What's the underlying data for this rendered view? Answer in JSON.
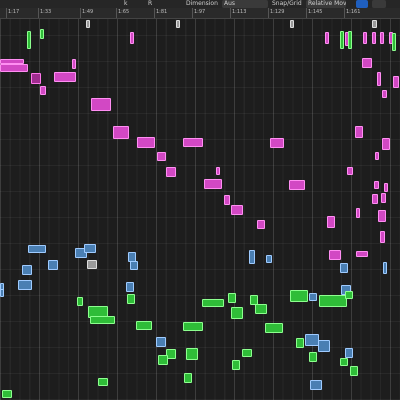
{
  "toolbar": {
    "glyph_a": "k",
    "glyph_b": "R",
    "dimension_label": "Dimension",
    "dimension_value": "Aus",
    "snap_label": "Snap/Grid",
    "quantize_value": "Relative Movement",
    "btn_1": "",
    "btn_2": ""
  },
  "ruler": {
    "bars": [
      "1:17",
      "1:33",
      "1:49",
      "1:65",
      "1:81",
      "1:97",
      "1:113",
      "1:129",
      "1:145",
      "1:161"
    ]
  },
  "regions": [
    {
      "label": "",
      "color": "gray"
    },
    {
      "label": "",
      "color": "gray"
    },
    {
      "label": "",
      "color": "gray"
    },
    {
      "label": "",
      "color": "gray"
    },
    {
      "label": "",
      "color": "pink"
    },
    {
      "label": "",
      "color": "pink"
    },
    {
      "label": "",
      "color": "pink"
    },
    {
      "label": "",
      "color": "pink"
    },
    {
      "label": "",
      "color": "pink"
    },
    {
      "label": "",
      "color": "pink"
    },
    {
      "label": "",
      "color": "pink"
    },
    {
      "label": "",
      "color": "green"
    },
    {
      "label": "",
      "color": "green"
    },
    {
      "label": "",
      "color": "green"
    },
    {
      "label": "",
      "color": "green"
    },
    {
      "label": "",
      "color": "green"
    },
    {
      "label": "",
      "color": "pink"
    },
    {
      "label": "",
      "color": "pink"
    },
    {
      "label": "",
      "color": "pink"
    },
    {
      "label": "",
      "color": "pink"
    },
    {
      "label": "",
      "color": "dpink"
    },
    {
      "label": "",
      "color": "pink"
    },
    {
      "label": "",
      "color": "pink"
    },
    {
      "label": "",
      "color": "pink"
    },
    {
      "label": "",
      "color": "pink"
    },
    {
      "label": "",
      "color": "pink"
    },
    {
      "label": "",
      "color": "pink"
    },
    {
      "label": "",
      "color": "pink"
    },
    {
      "label": "",
      "color": "pink"
    },
    {
      "label": "",
      "color": "pink"
    },
    {
      "label": "",
      "color": "pink"
    },
    {
      "label": "",
      "color": "pink"
    },
    {
      "label": "",
      "color": "pink"
    },
    {
      "label": "",
      "color": "pink"
    },
    {
      "label": "",
      "color": "pink"
    },
    {
      "label": "",
      "color": "pink"
    },
    {
      "label": "",
      "color": "pink"
    },
    {
      "label": "",
      "color": "pink"
    },
    {
      "label": "",
      "color": "pink"
    },
    {
      "label": "",
      "color": "pink"
    },
    {
      "label": "",
      "color": "pink"
    },
    {
      "label": "",
      "color": "pink"
    },
    {
      "label": "",
      "color": "pink"
    },
    {
      "label": "",
      "color": "pink"
    },
    {
      "label": "",
      "color": "pink"
    },
    {
      "label": "",
      "color": "pink"
    },
    {
      "label": "",
      "color": "pink"
    },
    {
      "label": "",
      "color": "pink"
    },
    {
      "label": "",
      "color": "pink"
    },
    {
      "label": "",
      "color": "pink"
    },
    {
      "label": "",
      "color": "pink"
    },
    {
      "label": "",
      "color": "pink"
    },
    {
      "label": "",
      "color": "blue"
    },
    {
      "label": "",
      "color": "blue"
    },
    {
      "label": "",
      "color": "blue"
    },
    {
      "label": "",
      "color": "gray"
    },
    {
      "label": "",
      "color": "blue"
    },
    {
      "label": "",
      "color": "blue"
    },
    {
      "label": "",
      "color": "blue"
    },
    {
      "label": "",
      "color": "blue"
    },
    {
      "label": "",
      "color": "blue"
    },
    {
      "label": "",
      "color": "blue"
    },
    {
      "label": "",
      "color": "pink"
    },
    {
      "label": "",
      "color": "blue"
    },
    {
      "label": "",
      "color": "blue"
    },
    {
      "label": "",
      "color": "blue"
    },
    {
      "label": "",
      "color": "blue"
    },
    {
      "label": "",
      "color": "blue"
    },
    {
      "label": "",
      "color": "blue"
    },
    {
      "label": "",
      "color": "blue"
    },
    {
      "label": "",
      "color": "blue"
    },
    {
      "label": "",
      "color": "green"
    },
    {
      "label": "",
      "color": "green"
    },
    {
      "label": "",
      "color": "green"
    },
    {
      "label": "",
      "color": "green"
    },
    {
      "label": "",
      "color": "green"
    },
    {
      "label": "",
      "color": "green"
    },
    {
      "label": "",
      "color": "green"
    },
    {
      "label": "",
      "color": "green"
    },
    {
      "label": "",
      "color": "green"
    },
    {
      "label": "",
      "color": "green"
    },
    {
      "label": "",
      "color": "green"
    },
    {
      "label": "",
      "color": "green"
    },
    {
      "label": "",
      "color": "green"
    },
    {
      "label": "",
      "color": "green"
    },
    {
      "label": "",
      "color": "green"
    },
    {
      "label": "",
      "color": "green"
    },
    {
      "label": "",
      "color": "blue"
    },
    {
      "label": "",
      "color": "blue"
    },
    {
      "label": "",
      "color": "blue"
    },
    {
      "label": "",
      "color": "blue"
    },
    {
      "label": "",
      "color": "green"
    },
    {
      "label": "",
      "color": "green"
    },
    {
      "label": "",
      "color": "green"
    },
    {
      "label": "",
      "color": "green"
    },
    {
      "label": "",
      "color": "green"
    },
    {
      "label": "",
      "color": "green"
    },
    {
      "label": "",
      "color": "green"
    },
    {
      "label": "",
      "color": "green"
    },
    {
      "label": "",
      "color": "green"
    },
    {
      "label": "",
      "color": "green"
    },
    {
      "label": "",
      "color": "blue"
    },
    {
      "label": "",
      "color": "green"
    },
    {
      "label": "",
      "color": "green"
    },
    {
      "label": "",
      "color": "green"
    },
    {
      "label": "",
      "color": "green"
    },
    {
      "label": "",
      "color": "blue"
    }
  ]
}
